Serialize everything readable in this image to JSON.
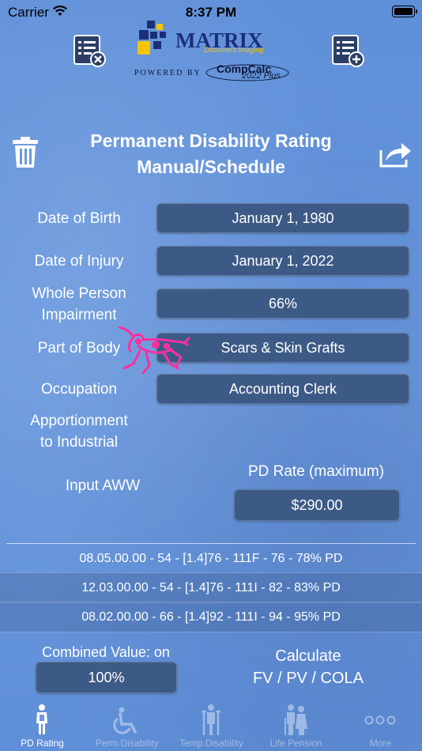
{
  "status_bar": {
    "carrier": "Carrier",
    "time": "8:37 PM"
  },
  "header": {
    "logo_text": "MATRIX",
    "logo_subtext": "Document Imaging",
    "powered_by": "POWERED BY",
    "compcalc": "CompCalc",
    "compcalc_version": "2022 Plus"
  },
  "title": {
    "line1": "Permanent Disability Rating",
    "line2": "Manual/Schedule"
  },
  "form": {
    "dob_label": "Date of Birth",
    "dob_value": "January 1, 1980",
    "doi_label": "Date of Injury",
    "doi_value": "January 1, 2022",
    "wpi_label1": "Whole Person",
    "wpi_label2": "Impairment",
    "wpi_value": "66%",
    "pob_label": "Part of Body",
    "pob_value": "Scars & Skin Grafts",
    "occ_label": "Occupation",
    "occ_value": "Accounting Clerk",
    "apport_label1": "Apportionment",
    "apport_label2": "to Industrial",
    "aww_label": "Input AWW",
    "pd_rate_label": "PD Rate (maximum)",
    "pd_rate_value": "$290.00"
  },
  "ratings": [
    "08.05.00.00 - 54 - [1.4]76 - 111F - 76 - 78% PD",
    "12.03.00.00 - 54 - [1.4]76 - 111I - 82 - 83% PD",
    "08.02.00.00 - 66 - [1.4]92 - 111I - 94 - 95% PD"
  ],
  "combined": {
    "label": "Combined Value: on",
    "value": "100%"
  },
  "calculate": {
    "line1": "Calculate",
    "line2": "FV / PV / COLA"
  },
  "tabs": [
    {
      "label": "PD Rating",
      "icon": "person-figure-icon"
    },
    {
      "label": "Perm.Disability",
      "icon": "wheelchair-icon"
    },
    {
      "label": "Temp.Disability",
      "icon": "crutches-icon"
    },
    {
      "label": "Life Pension",
      "icon": "elderly-couple-icon"
    },
    {
      "label": "More",
      "icon": "more-dots-icon"
    }
  ],
  "colors": {
    "background": "#6a99de",
    "field": "#3d5a86",
    "accent_pink": "#ff2fa0",
    "logo_yellow": "#f5c400",
    "logo_navy": "#1b2f78"
  }
}
